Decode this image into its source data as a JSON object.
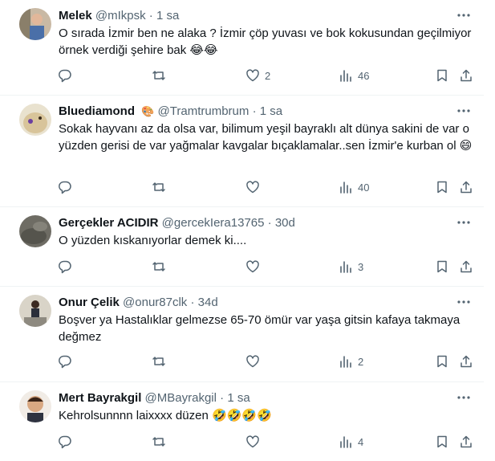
{
  "tweets": [
    {
      "name": "Melek",
      "handle": "@mIkpsk",
      "sep": "·",
      "time": "1 sa",
      "name_emoji": "",
      "text": "O sırada İzmir ben ne alaka ? İzmir çöp yuvası ve bok kokusundan geçilmiyor örnek verdiği şehire bak 😂😂",
      "counts": {
        "reply": "",
        "retweet": "",
        "like": "2",
        "views": "46"
      }
    },
    {
      "name": "Bluediamond",
      "handle": "@Tramtrumbrum",
      "sep": "·",
      "time": "1 sa",
      "name_emoji": "🎨",
      "text": "Sokak hayvanı az da olsa var, bilimum yeşil bayraklı alt dünya sakini de var o yüzden gerisi de var yağmalar kavgalar bıçaklamalar..sen İzmir'e kurban ol 😄",
      "counts": {
        "reply": "",
        "retweet": "",
        "like": "",
        "views": "40"
      }
    },
    {
      "name": "Gerçekler ACIDIR",
      "handle": "@gercekIera13765",
      "sep": "·",
      "time": "30d",
      "name_emoji": "",
      "text": "O yüzden kıskanıyorlar demek ki....",
      "counts": {
        "reply": "",
        "retweet": "",
        "like": "",
        "views": "3"
      }
    },
    {
      "name": "Onur Çelik",
      "handle": "@onur87clk",
      "sep": "·",
      "time": "34d",
      "name_emoji": "",
      "text": "Boşver ya Hastalıklar gelmezse  65-70 ömür var yaşa gitsin kafaya takmaya değmez",
      "counts": {
        "reply": "",
        "retweet": "",
        "like": "",
        "views": "2"
      }
    },
    {
      "name": "Mert Bayrakgil",
      "handle": "@MBayrakgil",
      "sep": "·",
      "time": "1 sa",
      "name_emoji": "",
      "text": "Kehrolsunnnn laixxxx düzen 🤣🤣🤣🤣",
      "counts": {
        "reply": "",
        "retweet": "",
        "like": "",
        "views": "4"
      }
    }
  ],
  "icons": {
    "reply": "reply-icon",
    "retweet": "retweet-icon",
    "like": "like-icon",
    "views": "views-icon",
    "bookmark": "bookmark-icon",
    "share": "share-icon",
    "more": "more-icon"
  },
  "colors": {
    "text": "#0f1419",
    "secondary": "#536471",
    "divider": "#eff3f4"
  }
}
